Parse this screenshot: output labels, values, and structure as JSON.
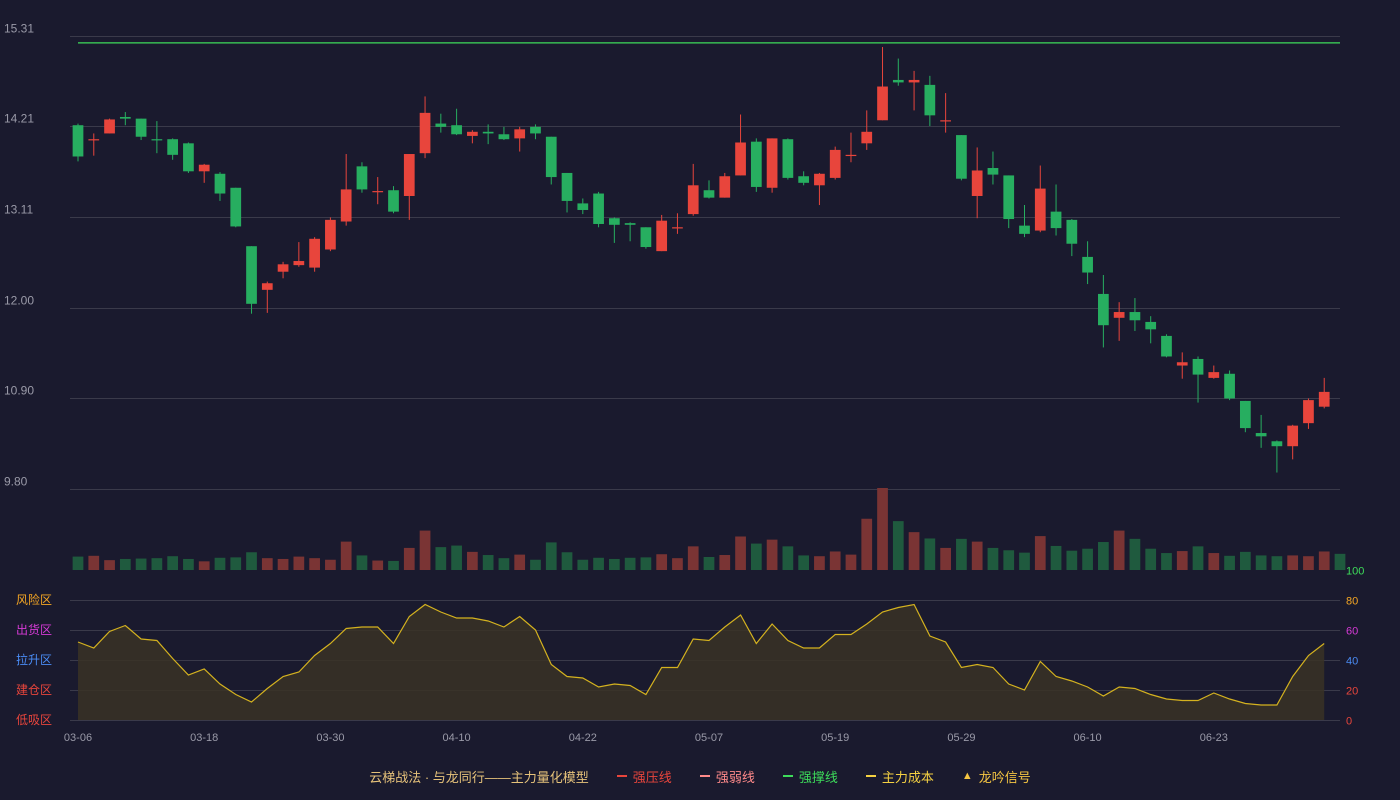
{
  "colors": {
    "background": "#1a1a2e",
    "grid": "#3a3a4a",
    "axis_text": "#9a9aa8",
    "up": "#e8453c",
    "down": "#27ae60",
    "vol_up": "#7a3434",
    "vol_down": "#1f5a3e",
    "osc_line": "#d4b21f",
    "osc_fill": "#3a3324",
    "resistance_line": "#3ddc5a"
  },
  "chart_data": [
    {
      "type": "candlestick",
      "title": "",
      "y_ticks": [
        "15.31",
        "14.21",
        "13.11",
        "12.00",
        "10.90",
        "9.80"
      ],
      "ylim": [
        9.8,
        15.31
      ],
      "grid": true,
      "x_ticks": [
        "03-06",
        "03-18",
        "03-30",
        "04-10",
        "04-22",
        "05-07",
        "05-19",
        "05-29",
        "06-10",
        "06-23"
      ],
      "x_tick_index": [
        0,
        8,
        16,
        24,
        32,
        40,
        48,
        56,
        64,
        72
      ],
      "horizontal_line": 15.22,
      "candles": [
        [
          14.22,
          13.84,
          14.24,
          13.78
        ],
        [
          14.05,
          14.05,
          14.12,
          13.85
        ],
        [
          14.12,
          14.29,
          14.3,
          14.12
        ],
        [
          14.32,
          14.3,
          14.38,
          14.22
        ],
        [
          14.3,
          14.08,
          14.3,
          14.04
        ],
        [
          14.05,
          14.04,
          14.27,
          13.88
        ],
        [
          14.05,
          13.86,
          14.06,
          13.8
        ],
        [
          14.0,
          13.66,
          14.01,
          13.64
        ],
        [
          13.66,
          13.74,
          13.75,
          13.52
        ],
        [
          13.63,
          13.39,
          13.65,
          13.3
        ],
        [
          13.46,
          12.99,
          13.46,
          12.98
        ],
        [
          12.75,
          12.05,
          12.75,
          11.93
        ],
        [
          12.22,
          12.3,
          12.32,
          11.94
        ],
        [
          12.44,
          12.53,
          12.56,
          12.36
        ],
        [
          12.52,
          12.57,
          12.8,
          12.5
        ],
        [
          12.49,
          12.84,
          12.86,
          12.44
        ],
        [
          12.71,
          13.07,
          13.1,
          12.69
        ],
        [
          13.05,
          13.44,
          13.87,
          13.0
        ],
        [
          13.72,
          13.44,
          13.77,
          13.4
        ],
        [
          13.41,
          13.42,
          13.59,
          13.26
        ],
        [
          13.43,
          13.17,
          13.48,
          13.15
        ],
        [
          13.36,
          13.87,
          13.87,
          13.07
        ],
        [
          13.88,
          14.37,
          14.57,
          13.82
        ],
        [
          14.24,
          14.2,
          14.36,
          14.13
        ],
        [
          14.22,
          14.11,
          14.42,
          14.1
        ],
        [
          14.09,
          14.14,
          14.16,
          14.0
        ],
        [
          14.14,
          14.12,
          14.23,
          13.99
        ],
        [
          14.11,
          14.05,
          14.2,
          14.04
        ],
        [
          14.06,
          14.17,
          14.2,
          13.9
        ],
        [
          14.2,
          14.12,
          14.23,
          14.05
        ],
        [
          14.08,
          13.59,
          14.08,
          13.5
        ],
        [
          13.64,
          13.3,
          13.64,
          13.16
        ],
        [
          13.27,
          13.19,
          13.33,
          13.14
        ],
        [
          13.39,
          13.02,
          13.41,
          12.98
        ],
        [
          13.09,
          13.01,
          13.1,
          12.79
        ],
        [
          13.03,
          13.01,
          13.04,
          12.81
        ],
        [
          12.98,
          12.74,
          12.98,
          12.72
        ],
        [
          12.69,
          13.06,
          13.13,
          12.69
        ],
        [
          12.98,
          12.98,
          13.15,
          12.9
        ],
        [
          13.14,
          13.49,
          13.75,
          13.12
        ],
        [
          13.43,
          13.34,
          13.55,
          13.33
        ],
        [
          13.34,
          13.6,
          13.64,
          13.34
        ],
        [
          13.61,
          14.01,
          14.35,
          13.61
        ],
        [
          14.02,
          13.47,
          14.06,
          13.41
        ],
        [
          13.46,
          14.06,
          14.06,
          13.4
        ],
        [
          14.05,
          13.58,
          14.06,
          13.56
        ],
        [
          13.6,
          13.52,
          13.66,
          13.49
        ],
        [
          13.49,
          13.63,
          13.64,
          13.25
        ],
        [
          13.58,
          13.92,
          13.96,
          13.56
        ],
        [
          13.86,
          13.86,
          14.13,
          13.77
        ],
        [
          14.0,
          14.14,
          14.4,
          13.92
        ],
        [
          14.28,
          14.69,
          15.17,
          14.28
        ],
        [
          14.77,
          14.74,
          15.03,
          14.7
        ],
        [
          14.74,
          14.77,
          14.88,
          14.4
        ],
        [
          14.71,
          14.34,
          14.82,
          14.21
        ],
        [
          14.28,
          14.28,
          14.61,
          14.13
        ],
        [
          14.1,
          13.57,
          14.1,
          13.55
        ],
        [
          13.36,
          13.67,
          13.95,
          13.09
        ],
        [
          13.7,
          13.62,
          13.9,
          13.5
        ],
        [
          13.61,
          13.08,
          13.61,
          12.97
        ],
        [
          13.0,
          12.9,
          13.25,
          12.86
        ],
        [
          12.94,
          13.45,
          13.73,
          12.92
        ],
        [
          13.17,
          12.97,
          13.5,
          12.88
        ],
        [
          13.07,
          12.78,
          13.08,
          12.63
        ],
        [
          12.62,
          12.43,
          12.81,
          12.29
        ],
        [
          12.17,
          11.79,
          12.4,
          11.52
        ],
        [
          11.88,
          11.95,
          12.07,
          11.6
        ],
        [
          11.95,
          11.85,
          12.12,
          11.72
        ],
        [
          11.83,
          11.74,
          11.9,
          11.57
        ],
        [
          11.66,
          11.41,
          11.68,
          11.4
        ],
        [
          11.3,
          11.34,
          11.46,
          11.14
        ],
        [
          11.38,
          11.19,
          11.41,
          10.85
        ],
        [
          11.15,
          11.22,
          11.3,
          11.14
        ],
        [
          11.2,
          10.9,
          11.24,
          10.88
        ],
        [
          10.87,
          10.54,
          10.87,
          10.49
        ],
        [
          10.48,
          10.44,
          10.7,
          10.3
        ],
        [
          10.38,
          10.32,
          10.39,
          10.0
        ],
        [
          10.32,
          10.57,
          10.58,
          10.16
        ],
        [
          10.6,
          10.88,
          10.9,
          10.53
        ],
        [
          10.8,
          10.98,
          11.15,
          10.78
        ]
      ],
      "volume": [
        34,
        36,
        25,
        28,
        29,
        30,
        35,
        28,
        22,
        31,
        32,
        45,
        30,
        28,
        34,
        30,
        26,
        72,
        37,
        24,
        23,
        56,
        100,
        58,
        62,
        46,
        38,
        30,
        39,
        26,
        70,
        45,
        26,
        31,
        28,
        31,
        32,
        40,
        30,
        60,
        33,
        38,
        85,
        67,
        77,
        60,
        37,
        35,
        47,
        39,
        130,
        208,
        124,
        96,
        80,
        56,
        79,
        72,
        56,
        50,
        44,
        86,
        61,
        49,
        54,
        71,
        100,
        79,
        54,
        43,
        48,
        60,
        43,
        36,
        46,
        37,
        35,
        37,
        35,
        47,
        41
      ]
    },
    {
      "type": "area",
      "title": "",
      "ylim": [
        0,
        100
      ],
      "y_ticks": [
        "100",
        "80",
        "60",
        "40",
        "20",
        "0"
      ],
      "zones": [
        "风险区",
        "出货区",
        "拉升区",
        "建仓区",
        "低吸区"
      ],
      "values": [
        52,
        48,
        59,
        63,
        54,
        53,
        41,
        30,
        34,
        24,
        17,
        12,
        21,
        29,
        32,
        43,
        51,
        61,
        62,
        62,
        51,
        69,
        77,
        72,
        68,
        68,
        66,
        62,
        69,
        60,
        37,
        29,
        28,
        22,
        24,
        23,
        17,
        35,
        35,
        54,
        53,
        62,
        70,
        51,
        64,
        53,
        48,
        48,
        57,
        57,
        64,
        72,
        75,
        77,
        56,
        52,
        35,
        37,
        35,
        24,
        20,
        39,
        29,
        26,
        22,
        16,
        22,
        21,
        17,
        14,
        13,
        13,
        18,
        14,
        11,
        10,
        10,
        29,
        43,
        51
      ]
    }
  ],
  "legend": {
    "items": [
      {
        "label": "云梯战法 · 与龙同行——主力量化模型",
        "color": "#e6c27a",
        "kind": "text"
      },
      {
        "label": "强压线",
        "color": "#e8453c",
        "kind": "line"
      },
      {
        "label": "强弱线",
        "color": "#ff8a8a",
        "kind": "dash"
      },
      {
        "label": "强撑线",
        "color": "#3ddc5a",
        "kind": "line"
      },
      {
        "label": "主力成本",
        "color": "#f5d142",
        "kind": "dash"
      },
      {
        "label": "龙吟信号",
        "color": "#f5c542",
        "kind": "triangle"
      }
    ]
  }
}
